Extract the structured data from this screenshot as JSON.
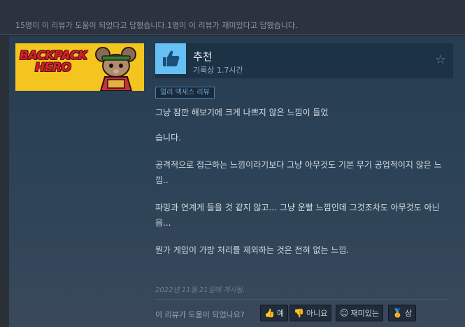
{
  "summary": {
    "helpful_text": "15명이 이 리뷰가 도움이 되었다고 답했습니다.1명이 이 리뷰가 재미있다고 답했습니다."
  },
  "game": {
    "banner_line1": "BACKPACK",
    "banner_line2": "HERO"
  },
  "review": {
    "recommendation": "추천",
    "hours": "기록상 1.7시간",
    "badge": "얼리 액세스 리뷰",
    "paragraphs": [
      "그냥 잠깐 해보기에 크게 나쁘지 않은 느낌이 들었",
      "습니다.",
      "공격적으로 접근하는 느낌이라기보다 그냥 아무것도 기본 무기 공업적이지 않은 느낌..",
      "파밍과 연계게 들을 것 같지 않고... 그냥 운빨 느낌인데 그것조차도 아무것도 아닌음...",
      "뭔가 게임이 가방 처리를 제외하는 것은 전혀 없는 느낌."
    ],
    "posted": "2022년 11월 21일에 게시됨."
  },
  "footer": {
    "question": "이 리뷰가 도움이 되었나요?",
    "buttons": {
      "yes": "예",
      "no": "아니요",
      "funny": "재미있는",
      "award": "상"
    }
  },
  "colors": {
    "accent": "#66c0f4",
    "badge_text": "#67a4d1",
    "banner_bg": "#f4c51e"
  },
  "icons": {
    "thumb": "thumbs-up-icon",
    "star": "star-outline-icon",
    "yes": "thumbs-up-icon",
    "no": "thumbs-down-icon",
    "funny": "smiley-icon",
    "award": "award-medal-icon"
  }
}
